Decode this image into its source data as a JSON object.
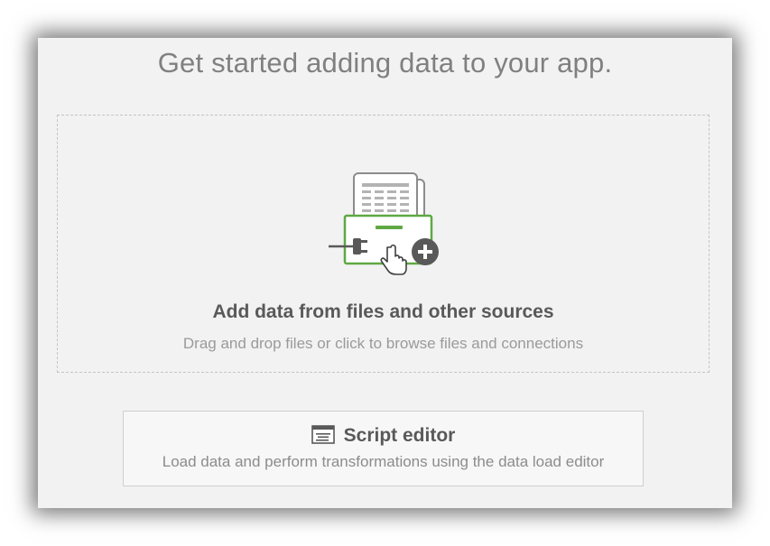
{
  "dialog": {
    "title": "Get started adding data to your app."
  },
  "dropzone": {
    "heading": "Add data from files and other sources",
    "subtitle": "Drag and drop files or click to browse files and connections",
    "icons": [
      "document-stack-icon",
      "plug-icon",
      "plus-circle-icon",
      "hand-cursor-icon"
    ]
  },
  "script_editor": {
    "label": "Script editor",
    "description": "Load data and perform transformations using the data load editor",
    "icon": "script-editor-icon"
  },
  "colors": {
    "accent_green": "#5fa844",
    "icon_gray": "#595959",
    "dialog_bg": "#f2f2f2"
  }
}
